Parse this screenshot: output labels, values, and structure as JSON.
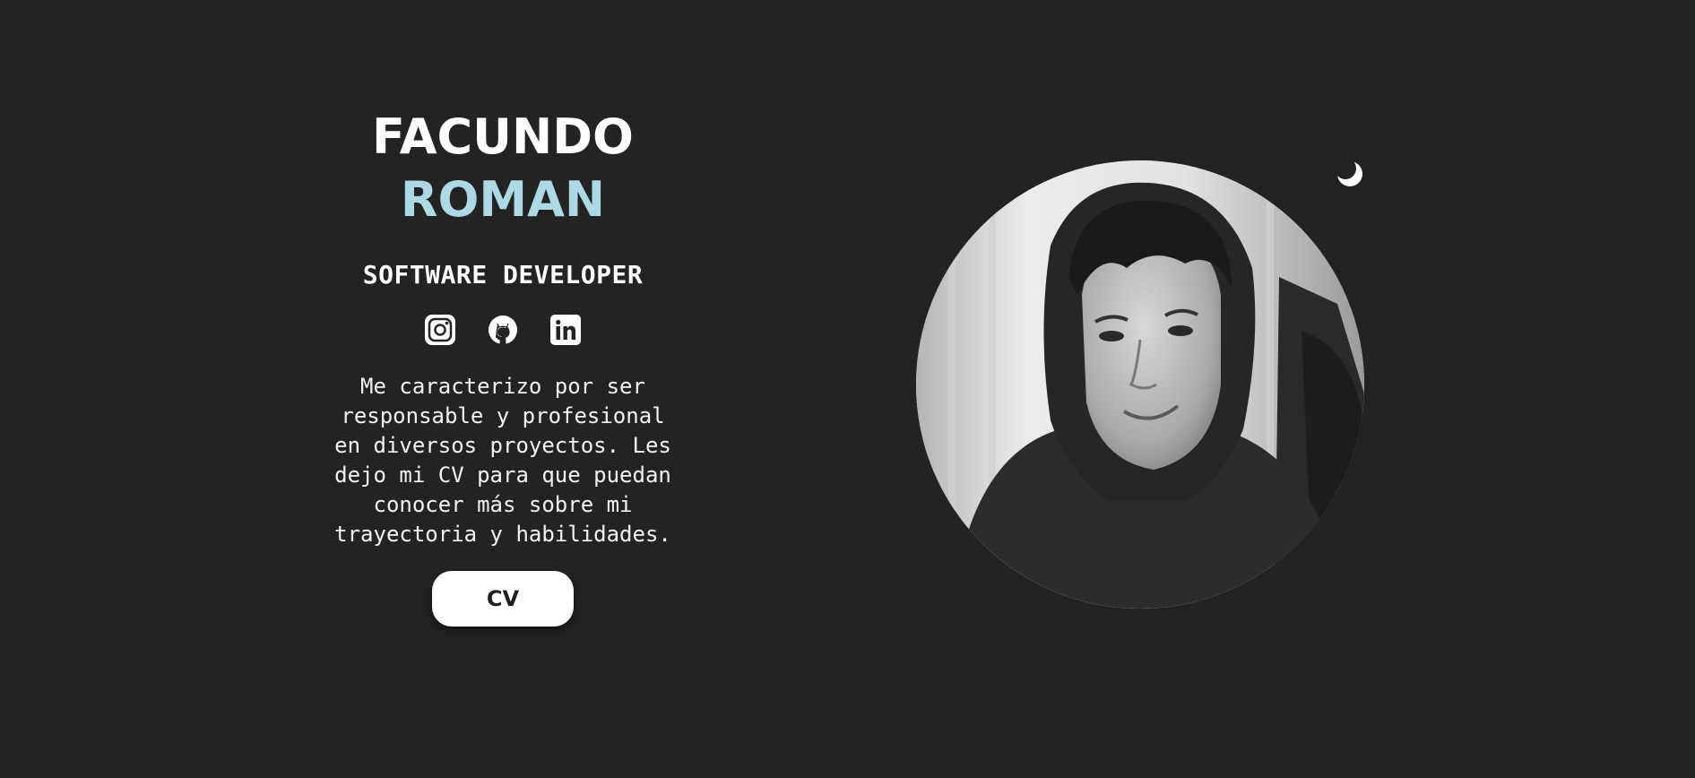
{
  "hero": {
    "first_name": "FACUNDO",
    "last_name": "ROMAN",
    "role": "SOFTWARE DEVELOPER",
    "bio": "Me caracterizo por ser responsable y profesional en diversos proyectos. Les dejo mi CV para que puedan conocer más sobre mi trayectoria y habilidades.",
    "cv_button_label": "CV"
  },
  "socials": [
    {
      "icon": "instagram-icon"
    },
    {
      "icon": "github-icon"
    },
    {
      "icon": "linkedin-icon"
    }
  ],
  "theme_toggle": {
    "icon": "moon-icon"
  },
  "colors": {
    "background": "#232323",
    "accent": "#add8e6",
    "text": "#ffffff",
    "button_bg": "#ffffff",
    "button_text": "#1f1f1f"
  }
}
